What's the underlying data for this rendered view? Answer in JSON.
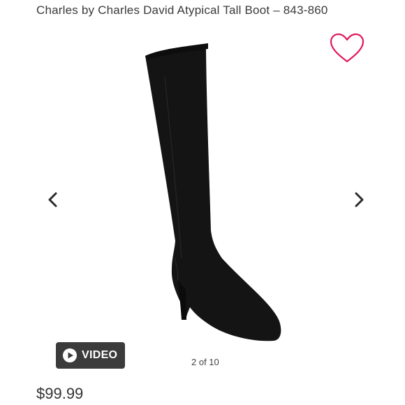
{
  "product": {
    "title": "Charles by Charles David Atypical Tall Boot  – 843-860",
    "price": "$99.99"
  },
  "gallery": {
    "counter": "2 of 10",
    "video_label": "VIDEO",
    "image_alt": "Black suede pointed-toe knee-high boot"
  },
  "icons": {
    "favorite": "heart-icon",
    "prev": "chevron-left-icon",
    "next": "chevron-right-icon",
    "play": "play-icon"
  },
  "colors": {
    "favorite_accent": "#e0185a",
    "video_button_bg": "#3b3b3b",
    "boot": "#141414"
  }
}
